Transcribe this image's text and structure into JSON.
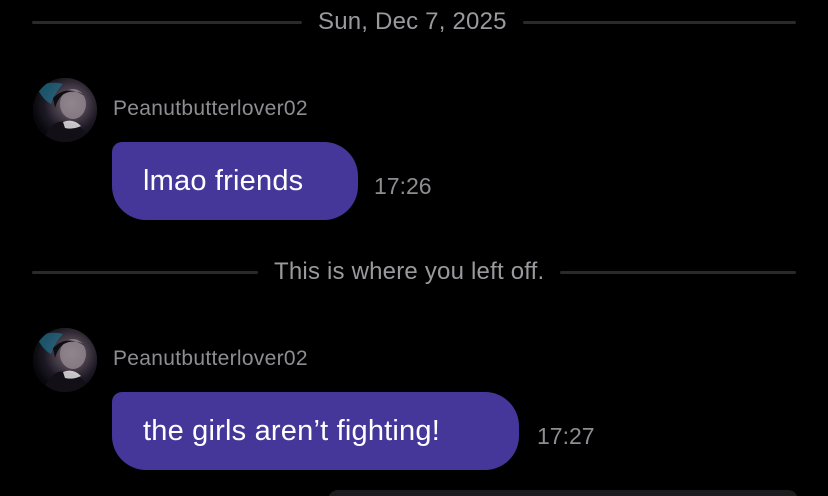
{
  "dividers": {
    "date_label": "Sun, Dec 7, 2025",
    "left_off_label": "This is where you left off."
  },
  "messages": [
    {
      "username": "Peanutbutterlover02",
      "text": "lmao friends",
      "time": "17:26",
      "avatar_icon": "user-avatar-photo"
    },
    {
      "username": "Peanutbutterlover02",
      "text": "the girls aren’t fighting!",
      "time": "17:27",
      "avatar_icon": "user-avatar-photo"
    }
  ],
  "colors": {
    "background": "#000000",
    "bubble": "#45379a",
    "bubble_text": "#ffffff",
    "meta_text": "#8d8d92",
    "divider_line": "#2a2a2c"
  }
}
